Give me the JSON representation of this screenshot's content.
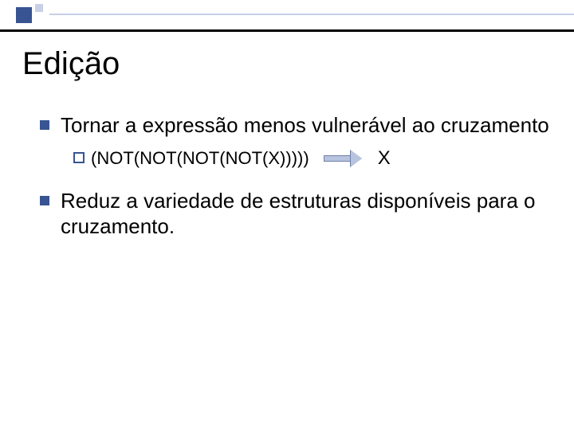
{
  "title": "Edição",
  "bullets": [
    {
      "text": "Tornar a expressão menos vulnerável ao cruzamento",
      "sub": [
        {
          "expr": "(NOT(NOT(NOT(NOT(X)))))",
          "result": "X"
        }
      ]
    },
    {
      "text": "Reduz a variedade de estruturas disponíveis para o cruzamento."
    }
  ]
}
